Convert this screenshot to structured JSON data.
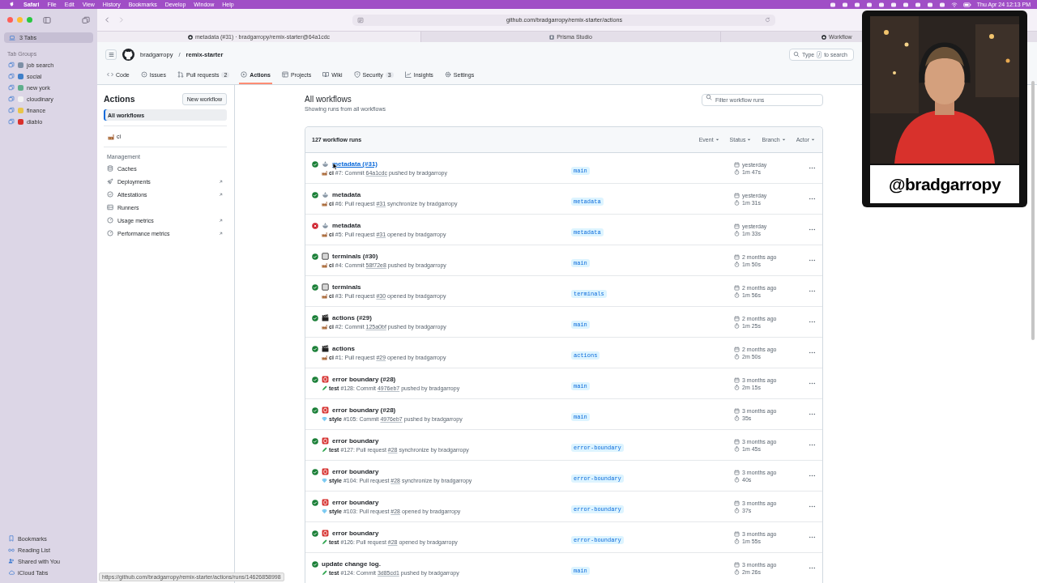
{
  "menu_bar": {
    "app": "Safari",
    "menus": [
      "File",
      "Edit",
      "View",
      "History",
      "Bookmarks",
      "Develop",
      "Window",
      "Help"
    ],
    "clock": "Thu Apr 24  12:13 PM"
  },
  "browser_sidebar": {
    "current": {
      "label": "3 Tabs",
      "selected": true
    },
    "group_heading": "Tab Groups",
    "groups": [
      {
        "label": "job search",
        "color": "#7d8fa6"
      },
      {
        "label": "social",
        "color": "#3f7fc9"
      },
      {
        "label": "new york",
        "color": "#5fae8c"
      },
      {
        "label": "cloudinary",
        "color": "#f2f2f2"
      },
      {
        "label": "finance",
        "color": "#e8c54a"
      },
      {
        "label": "diablo",
        "color": "#d9302c"
      }
    ],
    "footer": [
      {
        "kind": "bookmarks",
        "label": "Bookmarks"
      },
      {
        "kind": "reading",
        "label": "Reading List"
      },
      {
        "kind": "shared",
        "label": "Shared with You"
      },
      {
        "kind": "cloud",
        "label": "iCloud Tabs"
      }
    ]
  },
  "toolbar": {
    "address": "github.com/bradgarropy/remix-starter/actions"
  },
  "tabs": [
    {
      "label": "metadata (#31) · bradgarropy/remix-starter@64a1cdc",
      "kind": "github",
      "selected": true
    },
    {
      "label": "Prisma Studio",
      "kind": "prisma",
      "selected": false
    },
    {
      "label": "Workflow",
      "kind": "github",
      "selected": false
    }
  ],
  "repo_header": {
    "owner": "bradgarropy",
    "separator": "/",
    "repo": "remix-starter",
    "search": {
      "before": "Type",
      "key": "/",
      "after": "to search"
    }
  },
  "repo_tabs": [
    {
      "label": "Code",
      "selected": false
    },
    {
      "label": "Issues",
      "selected": false
    },
    {
      "label": "Pull requests",
      "count": "2",
      "selected": false
    },
    {
      "label": "Actions",
      "selected": true
    },
    {
      "label": "Projects",
      "selected": false
    },
    {
      "label": "Wiki",
      "selected": false
    },
    {
      "label": "Security",
      "count": "3",
      "selected": false
    },
    {
      "label": "Insights",
      "selected": false
    },
    {
      "label": "Settings",
      "selected": false
    }
  ],
  "actions_sidebar": {
    "title": "Actions",
    "new_button": "New workflow",
    "all": {
      "label": "All workflows",
      "selected": true
    },
    "workflows": [
      {
        "label": "ci",
        "selected": false
      }
    ],
    "management_heading": "Management",
    "management": [
      {
        "label": "Caches",
        "external": false
      },
      {
        "label": "Deployments",
        "external": true
      },
      {
        "label": "Attestations",
        "external": true
      },
      {
        "label": "Runners",
        "external": false
      },
      {
        "label": "Usage metrics",
        "external": true
      },
      {
        "label": "Performance metrics",
        "external": true
      }
    ]
  },
  "runs": {
    "title": "All workflows",
    "subtitle": "Showing runs from all workflows",
    "filter_placeholder": "Filter workflow runs",
    "count": "127 workflow runs",
    "filters": [
      "Event",
      "Status",
      "Branch",
      "Actor"
    ],
    "rows": [
      {
        "kind": "success",
        "emoji_icon": {
          "kind": "teapot"
        },
        "title": "metadata (#31)",
        "hovered": true,
        "workflow_icon": {
          "kind": "factory"
        },
        "prefix": "**ci** #7: Commit",
        "ref": "64a1cdc",
        "suffix": "pushed by bradgarropy",
        "branch": "main",
        "date": "yesterday",
        "duration": "1m 47s"
      },
      {
        "kind": "success",
        "emoji_icon": {
          "kind": "teapot"
        },
        "title": "metadata",
        "hovered": false,
        "workflow_icon": {
          "kind": "factory"
        },
        "prefix": "**ci** #6: Pull request",
        "ref": "#31",
        "suffix": "synchronize by bradgarropy",
        "branch": "metadata",
        "date": "yesterday",
        "duration": "1m 31s"
      },
      {
        "kind": "failure",
        "emoji_icon": {
          "kind": "teapot"
        },
        "title": "metadata",
        "hovered": false,
        "workflow_icon": {
          "kind": "factory"
        },
        "prefix": "**ci** #5: Pull request",
        "ref": "#31",
        "suffix": "opened by bradgarropy",
        "branch": "metadata",
        "date": "yesterday",
        "duration": "1m 33s"
      },
      {
        "kind": "success",
        "emoji_icon": {
          "kind": "terminal"
        },
        "title": "terminals (#30)",
        "hovered": false,
        "workflow_icon": {
          "kind": "factory"
        },
        "prefix": "**ci** #4: Commit",
        "ref": "58f72e8",
        "suffix": "pushed by bradgarropy",
        "branch": "main",
        "date": "2 months ago",
        "duration": "1m 50s"
      },
      {
        "kind": "success",
        "emoji_icon": {
          "kind": "terminal"
        },
        "title": "terminals",
        "hovered": false,
        "workflow_icon": {
          "kind": "factory"
        },
        "prefix": "**ci** #3: Pull request",
        "ref": "#30",
        "suffix": "opened by bradgarropy",
        "branch": "terminals",
        "date": "2 months ago",
        "duration": "1m 56s"
      },
      {
        "kind": "success",
        "emoji_icon": {
          "kind": "clapper"
        },
        "title": "actions (#29)",
        "hovered": false,
        "workflow_icon": {
          "kind": "factory"
        },
        "prefix": "**ci** #2: Commit",
        "ref": "125a0bf",
        "suffix": "pushed by bradgarropy",
        "branch": "main",
        "date": "2 months ago",
        "duration": "1m 25s"
      },
      {
        "kind": "success",
        "emoji_icon": {
          "kind": "clapper"
        },
        "title": "actions",
        "hovered": false,
        "workflow_icon": {
          "kind": "factory"
        },
        "prefix": "**ci** #1: Pull request",
        "ref": "#29",
        "suffix": "opened by bradgarropy",
        "branch": "actions",
        "date": "2 months ago",
        "duration": "2m 50s"
      },
      {
        "kind": "success",
        "emoji_icon": {
          "kind": "block"
        },
        "title": "error boundary (#28)",
        "hovered": false,
        "workflow_icon": {
          "kind": "pencil"
        },
        "prefix": "**test** #128: Commit",
        "ref": "4976eb7",
        "suffix": "pushed by bradgarropy",
        "branch": "main",
        "date": "3 months ago",
        "duration": "2m 15s"
      },
      {
        "kind": "success",
        "emoji_icon": {
          "kind": "block"
        },
        "title": "error boundary (#28)",
        "hovered": false,
        "workflow_icon": {
          "kind": "gem"
        },
        "prefix": "**style** #105: Commit",
        "ref": "4976eb7",
        "suffix": "pushed by bradgarropy",
        "branch": "main",
        "date": "3 months ago",
        "duration": "35s"
      },
      {
        "kind": "success",
        "emoji_icon": {
          "kind": "block"
        },
        "title": "error boundary",
        "hovered": false,
        "workflow_icon": {
          "kind": "pencil"
        },
        "prefix": "**test** #127: Pull request",
        "ref": "#28",
        "suffix": "synchronize by bradgarropy",
        "branch": "error-boundary",
        "date": "3 months ago",
        "duration": "1m 45s"
      },
      {
        "kind": "success",
        "emoji_icon": {
          "kind": "block"
        },
        "title": "error boundary",
        "hovered": false,
        "workflow_icon": {
          "kind": "gem"
        },
        "prefix": "**style** #104: Pull request",
        "ref": "#28",
        "suffix": "synchronize by bradgarropy",
        "branch": "error-boundary",
        "date": "3 months ago",
        "duration": "40s"
      },
      {
        "kind": "success",
        "emoji_icon": {
          "kind": "block"
        },
        "title": "error boundary",
        "hovered": false,
        "workflow_icon": {
          "kind": "gem"
        },
        "prefix": "**style** #103: Pull request",
        "ref": "#28",
        "suffix": "opened by bradgarropy",
        "branch": "error-boundary",
        "date": "3 months ago",
        "duration": "37s"
      },
      {
        "kind": "success",
        "emoji_icon": {
          "kind": "block"
        },
        "title": "error boundary",
        "hovered": false,
        "workflow_icon": {
          "kind": "pencil"
        },
        "prefix": "**test** #126: Pull request",
        "ref": "#28",
        "suffix": "opened by bradgarropy",
        "branch": "error-boundary",
        "date": "3 months ago",
        "duration": "1m 55s"
      },
      {
        "kind": "success",
        "title": "update change log.",
        "hovered": false,
        "workflow_icon": {
          "kind": "pencil"
        },
        "prefix": "**test** #124: Commit",
        "ref": "3d85cd1",
        "suffix": "pushed by bradgarropy",
        "branch": "main",
        "date": "3 months ago",
        "duration": "2m 26s"
      }
    ]
  },
  "status_url": "https://github.com/bradgarropy/remix-starter/actions/runs/14626858998",
  "camera": {
    "kind": "picture",
    "handle": "@bradgarropy"
  }
}
